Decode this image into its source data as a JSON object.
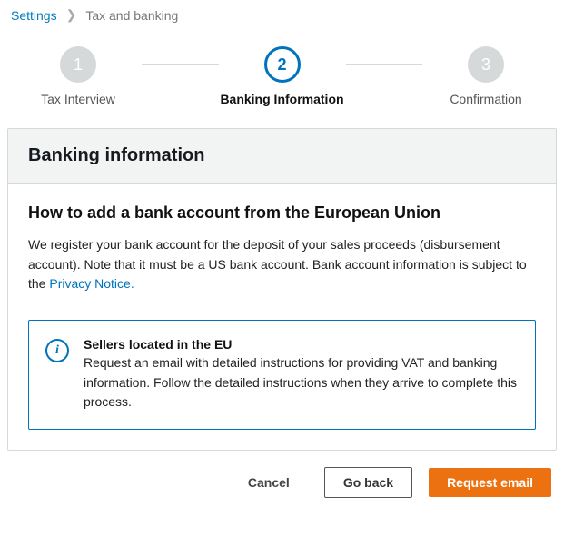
{
  "breadcrumb": {
    "root": "Settings",
    "current": "Tax and banking"
  },
  "stepper": {
    "steps": [
      {
        "num": "1",
        "label": "Tax Interview"
      },
      {
        "num": "2",
        "label": "Banking Information"
      },
      {
        "num": "3",
        "label": "Confirmation"
      }
    ]
  },
  "card": {
    "header": "Banking information",
    "section_title": "How to add a bank account from the European Union",
    "body_prefix": "We register your bank account for the deposit of your sales proceeds (disbursement account). Note that it must be a US bank account. Bank account information is subject to the ",
    "privacy_link": "Privacy Notice."
  },
  "info": {
    "title": "Sellers located in the EU",
    "body": "Request an email with detailed instructions for providing VAT and banking information. Follow the detailed instructions when they arrive to complete this process."
  },
  "actions": {
    "cancel": "Cancel",
    "goback": "Go back",
    "primary": "Request email"
  }
}
